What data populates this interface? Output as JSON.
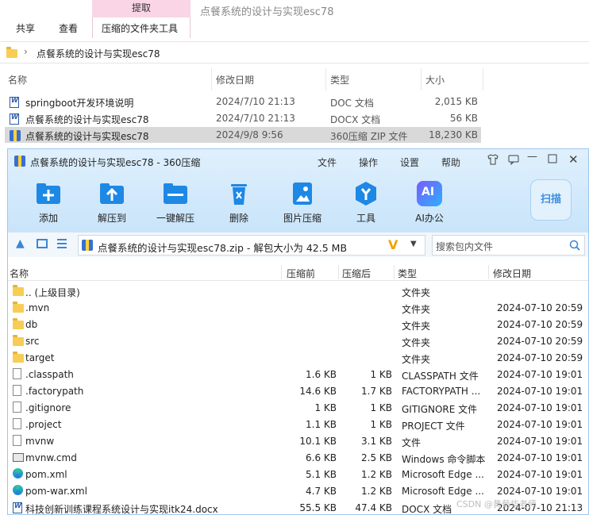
{
  "explorer": {
    "context_tab": "提取",
    "window_title": "点餐系统的设计与实现esc78",
    "tabs": [
      "共享",
      "查看",
      "压缩的文件夹工具"
    ],
    "breadcrumb": "点餐系统的设计与实现esc78",
    "columns": {
      "name": "名称",
      "modified": "修改日期",
      "type": "类型",
      "size": "大小"
    },
    "files": [
      {
        "name": "springboot开发环境说明",
        "modified": "2024/7/10 21:13",
        "type": "DOC 文档",
        "size": "2,015 KB",
        "icon": "word-doc-icon"
      },
      {
        "name": "点餐系统的设计与实现esc78",
        "modified": "2024/7/10 21:13",
        "type": "DOCX 文档",
        "size": "56 KB",
        "icon": "word-doc-icon"
      },
      {
        "name": "点餐系统的设计与实现esc78",
        "modified": "2024/9/8 9:56",
        "type": "360压缩 ZIP 文件",
        "size": "18,230 KB",
        "icon": "zip-archive-icon"
      }
    ]
  },
  "zip": {
    "title": "点餐系统的设计与实现esc78 - 360压缩",
    "menu": [
      "文件",
      "操作",
      "设置",
      "帮助"
    ],
    "toolbar": [
      "添加",
      "解压到",
      "一键解压",
      "删除",
      "图片压缩",
      "工具",
      "AI办公"
    ],
    "scan_label": "扫描",
    "path": "点餐系统的设计与实现esc78.zip - 解包大小为 42.5 MB",
    "search_placeholder": "搜索包内文件",
    "columns": {
      "name": "名称",
      "compressed": "压缩前",
      "after": "压缩后",
      "type": "类型",
      "modified": "修改日期"
    },
    "rows": [
      {
        "name": ".. (上级目录)",
        "before": "",
        "after": "",
        "type": "文件夹",
        "modified": "",
        "icon": "folder"
      },
      {
        "name": ".mvn",
        "before": "",
        "after": "",
        "type": "文件夹",
        "modified": "2024-07-10 20:59",
        "icon": "folder"
      },
      {
        "name": "db",
        "before": "",
        "after": "",
        "type": "文件夹",
        "modified": "2024-07-10 20:59",
        "icon": "folder"
      },
      {
        "name": "src",
        "before": "",
        "after": "",
        "type": "文件夹",
        "modified": "2024-07-10 20:59",
        "icon": "folder"
      },
      {
        "name": "target",
        "before": "",
        "after": "",
        "type": "文件夹",
        "modified": "2024-07-10 20:59",
        "icon": "folder"
      },
      {
        "name": ".classpath",
        "before": "1.6 KB",
        "after": "1 KB",
        "type": "CLASSPATH 文件",
        "modified": "2024-07-10 19:01",
        "icon": "file"
      },
      {
        "name": ".factorypath",
        "before": "14.6 KB",
        "after": "1.7 KB",
        "type": "FACTORYPATH ...",
        "modified": "2024-07-10 19:01",
        "icon": "file"
      },
      {
        "name": ".gitignore",
        "before": "1 KB",
        "after": "1 KB",
        "type": "GITIGNORE 文件",
        "modified": "2024-07-10 19:01",
        "icon": "file"
      },
      {
        "name": ".project",
        "before": "1.1 KB",
        "after": "1 KB",
        "type": "PROJECT 文件",
        "modified": "2024-07-10 19:01",
        "icon": "file"
      },
      {
        "name": "mvnw",
        "before": "10.1 KB",
        "after": "3.1 KB",
        "type": "文件",
        "modified": "2024-07-10 19:01",
        "icon": "file"
      },
      {
        "name": "mvnw.cmd",
        "before": "6.6 KB",
        "after": "2.5 KB",
        "type": "Windows 命令脚本",
        "modified": "2024-07-10 19:01",
        "icon": "cmd"
      },
      {
        "name": "pom.xml",
        "before": "5.1 KB",
        "after": "1.2 KB",
        "type": "Microsoft Edge ...",
        "modified": "2024-07-10 19:01",
        "icon": "edge"
      },
      {
        "name": "pom-war.xml",
        "before": "4.7 KB",
        "after": "1.2 KB",
        "type": "Microsoft Edge ...",
        "modified": "2024-07-10 19:01",
        "icon": "edge"
      },
      {
        "name": "科技创新训练课程系统设计与实现itk24.docx",
        "before": "55.5 KB",
        "after": "47.4 KB",
        "type": "DOCX 文档",
        "modified": "2024-07-10 21:13",
        "icon": "word"
      }
    ]
  },
  "watermark": "CSDN @黄菊华老师"
}
